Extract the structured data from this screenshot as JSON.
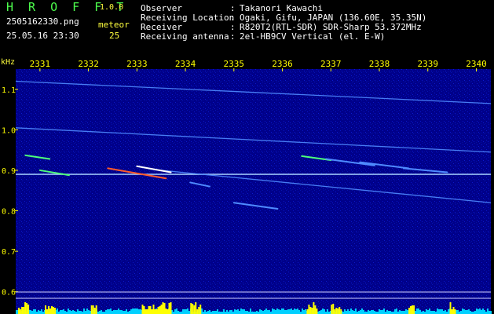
{
  "header": {
    "logo": "H R O F F T",
    "version": "1.0.0",
    "filename": "2505162330.png",
    "datetime": "25.05.16 23:30",
    "count_label": "meteor",
    "count_value": "25"
  },
  "station": {
    "rows": [
      {
        "label": "Observer",
        "sep": ":",
        "value": "Takanori Kawachi"
      },
      {
        "label": "Receiving Location",
        "sep": ":",
        "value": "Ogaki, Gifu, JAPAN (136.60E, 35.35N)"
      },
      {
        "label": "Receiver",
        "sep": ":",
        "value": "R820T2(RTL-SDR) SDR-Sharp 53.372MHz"
      },
      {
        "label": "Receiving antenna",
        "sep": ":",
        "value": "2el-HB9CV Vertical (el. E-W)"
      }
    ]
  },
  "chart_data": {
    "type": "spectrogram",
    "x_ticks": [
      "2331",
      "2332",
      "2333",
      "2334",
      "2335",
      "2336",
      "2337",
      "2338",
      "2339",
      "2340"
    ],
    "y_unit": "kHz",
    "y_ticks": [
      "1.1",
      "1.0",
      "0.9",
      "0.8",
      "0.7",
      "0.6"
    ],
    "ylim": [
      0.58,
      1.15
    ],
    "xlim": [
      2330.5,
      2340.3
    ],
    "colors": {
      "background": "#00008c",
      "trace": "#4f8bff",
      "carrier": "#a9d4ff",
      "meteor": "#4dff7a",
      "hot": "#ff5a2a",
      "bar_low": "#00d0ff",
      "bar_high": "#ffff00"
    },
    "traces": [
      {
        "kind": "drift",
        "points": [
          [
            2330.5,
            1.12
          ],
          [
            2340.3,
            1.065
          ]
        ]
      },
      {
        "kind": "drift",
        "points": [
          [
            2330.5,
            1.005
          ],
          [
            2340.3,
            0.945
          ]
        ]
      },
      {
        "kind": "carrier",
        "points": [
          [
            2330.5,
            0.89
          ],
          [
            2340.3,
            0.89
          ]
        ]
      },
      {
        "kind": "drift",
        "points": [
          [
            2333.5,
            0.9
          ],
          [
            2340.3,
            0.82
          ]
        ]
      }
    ],
    "meteors": [
      {
        "x0": 2330.7,
        "x1": 2331.2,
        "y0": 0.937,
        "y1": 0.928,
        "color": "#4dff7a"
      },
      {
        "x0": 2331.0,
        "x1": 2331.6,
        "y0": 0.9,
        "y1": 0.888,
        "color": "#4dff7a"
      },
      {
        "x0": 2332.4,
        "x1": 2333.6,
        "y0": 0.905,
        "y1": 0.88,
        "color": "#ff5a2a"
      },
      {
        "x0": 2333.0,
        "x1": 2333.7,
        "y0": 0.91,
        "y1": 0.895,
        "color": "#ffffff"
      },
      {
        "x0": 2334.1,
        "x1": 2334.5,
        "y0": 0.87,
        "y1": 0.86,
        "color": "#4f8bff"
      },
      {
        "x0": 2335.0,
        "x1": 2335.9,
        "y0": 0.82,
        "y1": 0.805,
        "color": "#4f8bff"
      },
      {
        "x0": 2336.4,
        "x1": 2337.0,
        "y0": 0.935,
        "y1": 0.925,
        "color": "#4dff7a"
      },
      {
        "x0": 2336.9,
        "x1": 2337.9,
        "y0": 0.928,
        "y1": 0.912,
        "color": "#4f8bff"
      },
      {
        "x0": 2337.6,
        "x1": 2338.6,
        "y0": 0.92,
        "y1": 0.905,
        "color": "#4f8bff"
      },
      {
        "x0": 2338.5,
        "x1": 2339.4,
        "y0": 0.905,
        "y1": 0.895,
        "color": "#4f8bff"
      }
    ],
    "bar_hot_segments": [
      [
        2330.55,
        2330.75
      ],
      [
        2331.1,
        2331.3
      ],
      [
        2332.05,
        2332.15
      ],
      [
        2333.1,
        2333.7
      ],
      [
        2334.1,
        2334.3
      ],
      [
        2336.5,
        2336.7
      ],
      [
        2337.0,
        2337.2
      ],
      [
        2338.6,
        2338.7
      ],
      [
        2339.45,
        2339.55
      ]
    ]
  }
}
